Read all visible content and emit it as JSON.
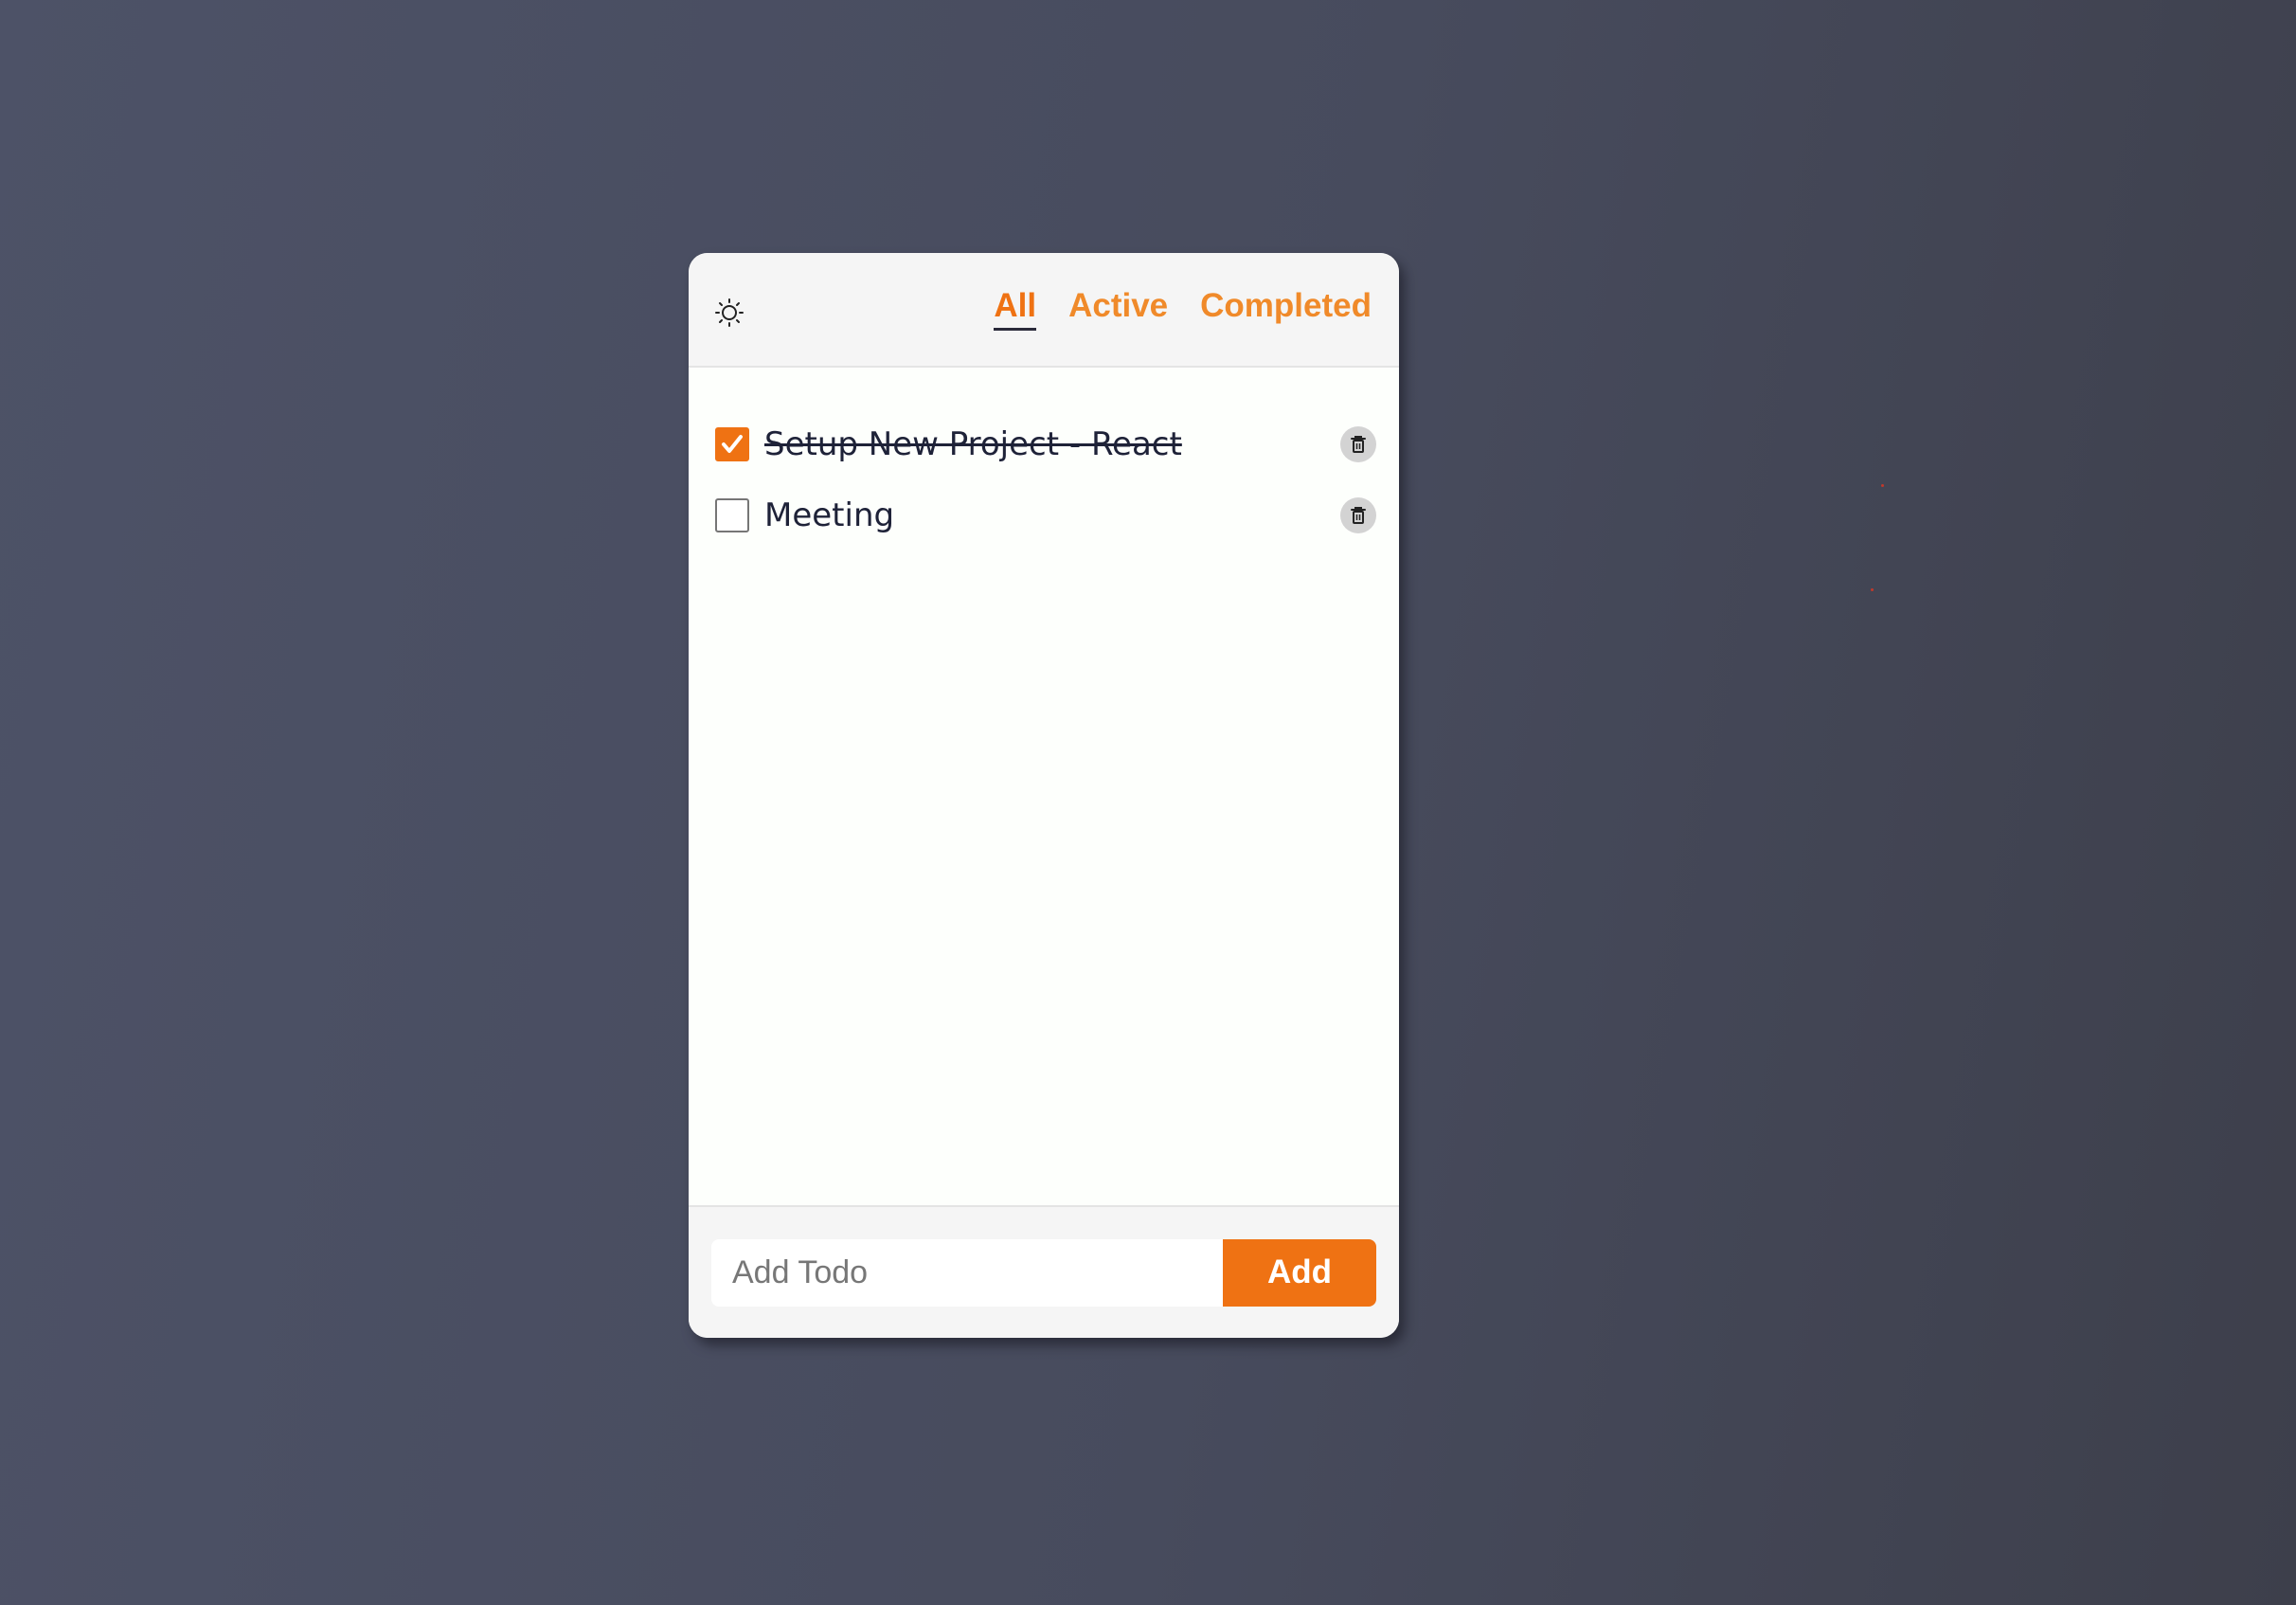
{
  "colors": {
    "accent": "#ef7213",
    "background_start": "#4d5267",
    "background_end": "#3d3f4b",
    "card": "#fdfffc",
    "text": "#1e2238"
  },
  "header": {
    "theme_icon": "sun-icon",
    "tabs": [
      {
        "label": "All",
        "active": true
      },
      {
        "label": "Active",
        "active": false
      },
      {
        "label": "Completed",
        "active": false
      }
    ]
  },
  "todos": [
    {
      "text": "Setup New Project - React",
      "completed": true,
      "delete_icon": "trash-icon"
    },
    {
      "text": "Meeting",
      "completed": false,
      "delete_icon": "trash-icon"
    }
  ],
  "footer": {
    "input_value": "",
    "input_placeholder": "Add Todo",
    "add_label": "Add"
  }
}
